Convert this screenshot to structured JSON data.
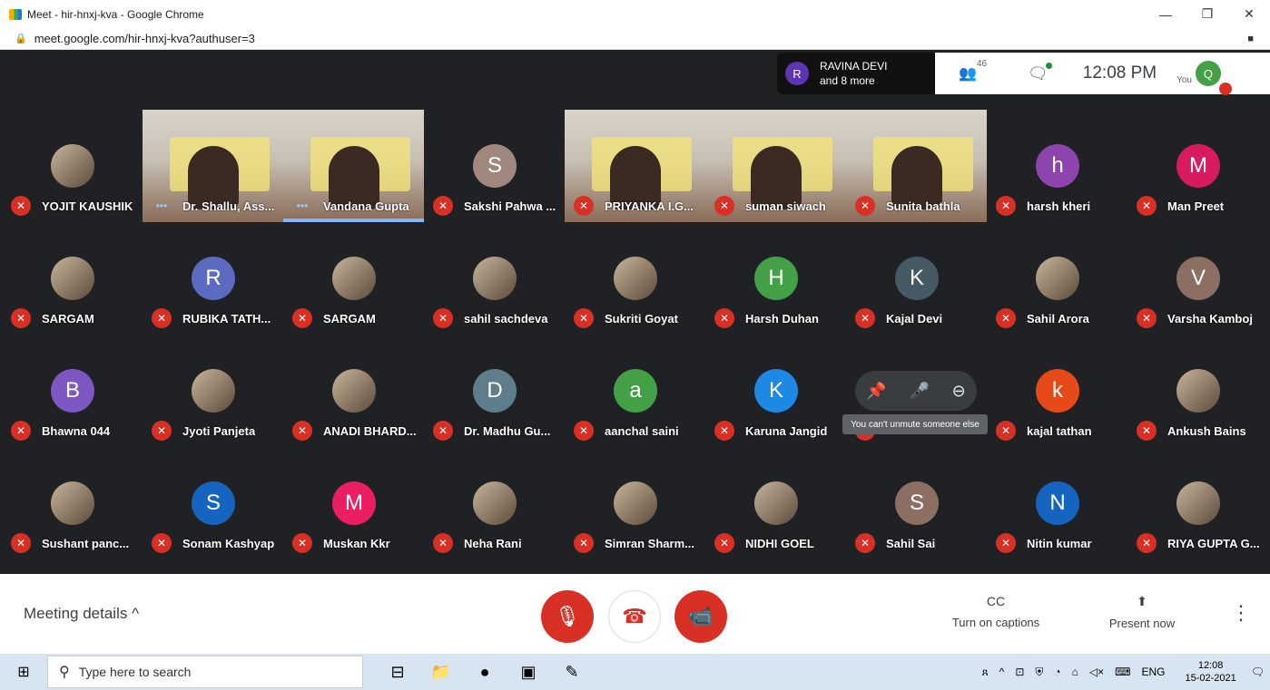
{
  "window": {
    "title": "Meet - hir-hnxj-kva - Google Chrome",
    "min": "—",
    "max": "❐",
    "close": "✕"
  },
  "address": {
    "url": "meet.google.com/hir-hnxj-kva?authuser=3",
    "lock": "🔒",
    "cam": "■"
  },
  "presenting": {
    "initial": "R",
    "name": "RAVINA DEVI",
    "more": "and 8 more"
  },
  "topbar": {
    "participants_icon": "👥",
    "participants_count": "46",
    "chat_icon": "🗨",
    "time": "12:08 PM",
    "you_label": "You",
    "you_initial": "Q"
  },
  "tiles": [
    {
      "name": "YOJIT KAUSHIK",
      "type": "photo",
      "muted": true
    },
    {
      "name": "Dr. Shallu, Ass...",
      "type": "video",
      "muted": false
    },
    {
      "name": "Vandana Gupta",
      "type": "video",
      "muted": false,
      "speaking": true
    },
    {
      "name": "Sakshi Pahwa ...",
      "type": "avatar",
      "initial": "S",
      "color": "#a1887f",
      "muted": true
    },
    {
      "name": "PRIYANKA I.G...",
      "type": "video",
      "muted": true
    },
    {
      "name": "suman siwach",
      "type": "video",
      "muted": true
    },
    {
      "name": "Sunita bathla",
      "type": "video",
      "muted": true
    },
    {
      "name": "harsh kheri",
      "type": "avatar",
      "initial": "h",
      "color": "#8e44ad",
      "muted": true
    },
    {
      "name": "Man Preet",
      "type": "avatar",
      "initial": "M",
      "color": "#d81b60",
      "muted": true
    },
    {
      "name": "SARGAM",
      "type": "photo",
      "muted": true
    },
    {
      "name": "RUBIKA TATH...",
      "type": "avatar",
      "initial": "R",
      "color": "#5c6bc0",
      "muted": true
    },
    {
      "name": "SARGAM",
      "type": "photo",
      "muted": true
    },
    {
      "name": "sahil sachdeva",
      "type": "photo",
      "muted": true
    },
    {
      "name": "Sukriti Goyat",
      "type": "photo",
      "muted": true
    },
    {
      "name": "Harsh Duhan",
      "type": "avatar",
      "initial": "H",
      "color": "#43a047",
      "muted": true
    },
    {
      "name": "Kajal Devi",
      "type": "avatar",
      "initial": "K",
      "color": "#455a64",
      "muted": true
    },
    {
      "name": "Sahil Arora",
      "type": "photo",
      "muted": true
    },
    {
      "name": "Varsha Kamboj",
      "type": "avatar",
      "initial": "V",
      "color": "#8d6e63",
      "muted": true
    },
    {
      "name": "Bhawna 044",
      "type": "avatar",
      "initial": "B",
      "color": "#7e57c2",
      "muted": true
    },
    {
      "name": "Jyoti Panjeta",
      "type": "photo",
      "muted": true
    },
    {
      "name": "ANADI BHARD...",
      "type": "photo",
      "muted": true
    },
    {
      "name": "Dr. Madhu Gu...",
      "type": "avatar",
      "initial": "D",
      "color": "#607d8b",
      "muted": true
    },
    {
      "name": "aanchal saini",
      "type": "avatar",
      "initial": "a",
      "color": "#43a047",
      "muted": true
    },
    {
      "name": "Karuna Jangid",
      "type": "avatar",
      "initial": "K",
      "color": "#1e88e5",
      "muted": true
    },
    {
      "name": "",
      "type": "hover",
      "muted": true
    },
    {
      "name": "kajal tathan",
      "type": "avatar",
      "initial": "k",
      "color": "#e64a19",
      "muted": true
    },
    {
      "name": "Ankush Bains",
      "type": "photo",
      "muted": true
    },
    {
      "name": "Sushant panc...",
      "type": "photo",
      "muted": true
    },
    {
      "name": "Sonam Kashyap",
      "type": "avatar",
      "initial": "S",
      "color": "#1565c0",
      "muted": true
    },
    {
      "name": "Muskan Kkr",
      "type": "avatar",
      "initial": "M",
      "color": "#e91e63",
      "muted": true
    },
    {
      "name": "Neha Rani",
      "type": "photo",
      "muted": true
    },
    {
      "name": "Simran Sharm...",
      "type": "photo",
      "muted": true
    },
    {
      "name": "NIDHI GOEL",
      "type": "photo",
      "muted": true
    },
    {
      "name": "Sahil Sai",
      "type": "avatar",
      "initial": "S",
      "color": "#8d6e63",
      "muted": true
    },
    {
      "name": "Nitin kumar",
      "type": "avatar",
      "initial": "N",
      "color": "#1565c0",
      "muted": true
    },
    {
      "name": "RIYA GUPTA G...",
      "type": "photo",
      "muted": true
    }
  ],
  "hover": {
    "pin_icon": "📌",
    "mute_icon": "🎤",
    "remove_icon": "⊖",
    "tooltip": "You can't unmute someone else"
  },
  "bottom": {
    "meeting_details": "Meeting details",
    "chevron": "^",
    "mic_icon": "🎙",
    "end_icon": "☎",
    "cam_icon": "📹",
    "captions_icon": "CC",
    "captions_label": "Turn on captions",
    "present_icon": "⬆",
    "present_label": "Present now",
    "more_icon": "⋮"
  },
  "taskbar": {
    "start_icon": "⊞",
    "search_icon": "⚲",
    "search_placeholder": "Type here to search",
    "apps": [
      "⊟",
      "📁",
      "●",
      "▣",
      "✎"
    ],
    "tray": [
      "ጸ",
      "^",
      "⊡",
      "⛨",
      "◔",
      "⌂",
      "◁×",
      "⌨",
      "ENG"
    ],
    "time": "12:08",
    "date": "15-02-2021",
    "notif_icon": "🗨"
  }
}
